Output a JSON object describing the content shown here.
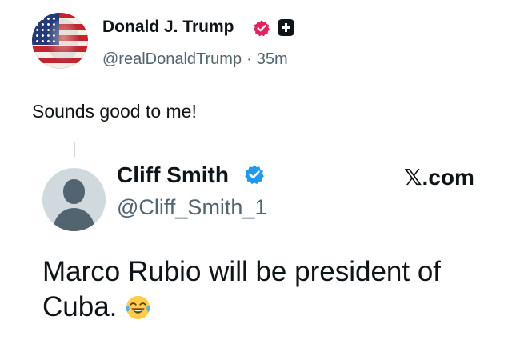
{
  "post": {
    "author": {
      "name": "Donald J. Trump",
      "handle": "@realDonaldTrump",
      "separator": "·",
      "time": "35m",
      "avatar_icon": "flag-portrait-avatar",
      "verified_icon": "verified-badge-gold",
      "affiliate_icon": "plus-badge-icon"
    },
    "text": "Sounds good to me!"
  },
  "quoted": {
    "author": {
      "name": "Cliff Smith",
      "handle": "@Cliff_Smith_1",
      "avatar_icon": "default-avatar",
      "verified_icon": "verified-badge-blue"
    },
    "source": "𝕏.com",
    "text_line1": "Marco Rubio will be president of",
    "text_line2": "Cuba.",
    "emoji": "face-with-tears-of-joy"
  },
  "colors": {
    "text": "#0f1419",
    "muted": "#536471",
    "verified_gold": "#e0245e",
    "verified_blue": "#1d9bf0",
    "avatar_placeholder": "#cfd9de"
  }
}
